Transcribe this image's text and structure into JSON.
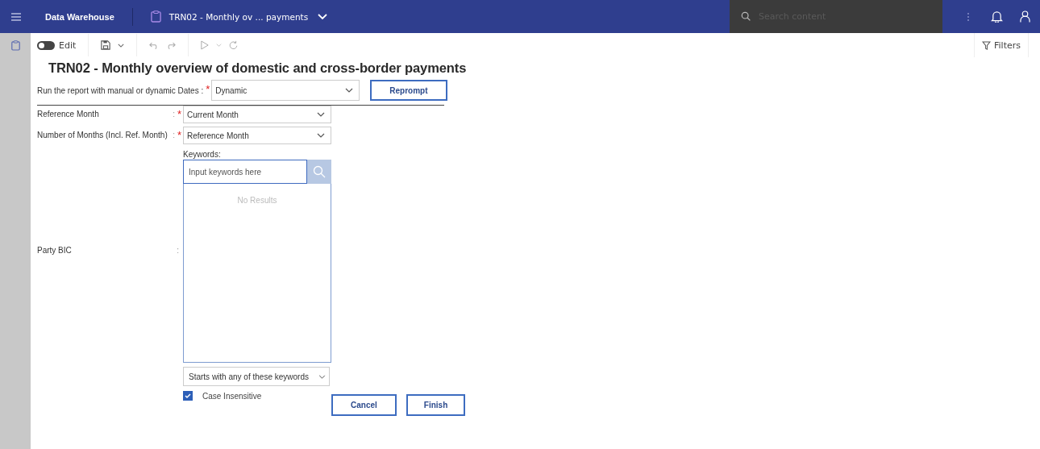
{
  "app_bar": {
    "product": "Data Warehouse",
    "report_tab": "TRN02 - Monthly ov ... payments",
    "search": {
      "placeholder": "Search content"
    }
  },
  "toolbar": {
    "edit_toggle": {
      "label": "Edit",
      "on": false
    },
    "filters": "Filters"
  },
  "report_title": "TRN02 - Monthly overview of domestic and cross-border payments",
  "mode_prompt": {
    "label": "Run the report with manual or dynamic Dates :",
    "required_mark": "*",
    "value": "Dynamic",
    "button": "Reprompt"
  },
  "prompts": [
    {
      "kind": "select",
      "label": "Reference Month",
      "separator": ":",
      "required_mark": "*",
      "value": "Current Month"
    },
    {
      "kind": "select",
      "label": "Number of Months (Incl. Ref. Month)",
      "separator": ":",
      "required_mark": "*",
      "value": "Reference Month"
    },
    {
      "kind": "search",
      "label": "Party BIC",
      "separator": ":",
      "keywords_label": "Keywords:",
      "placeholder": "Input keywords here",
      "results": "No Results",
      "match_mode": "Starts with any of these keywords",
      "case_insensitive": {
        "label": "Case Insensitive",
        "checked": true
      }
    }
  ],
  "buttons": [
    "Cancel",
    "Finish"
  ]
}
